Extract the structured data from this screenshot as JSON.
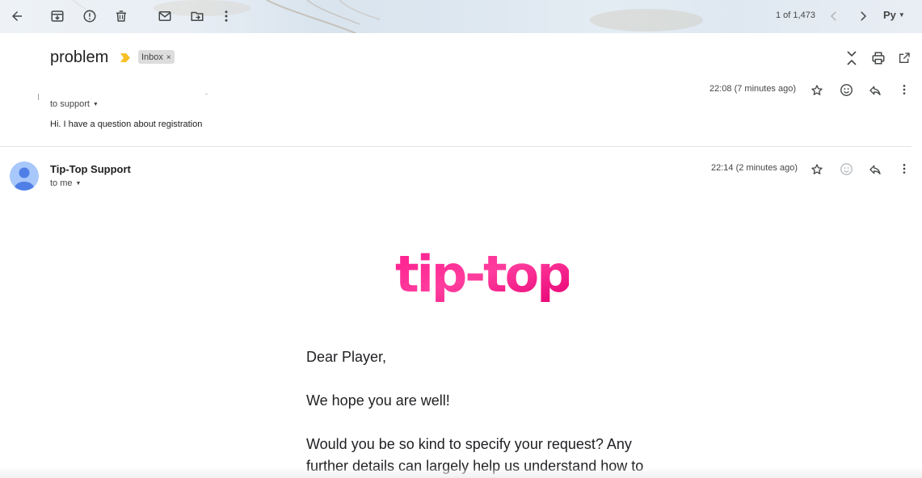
{
  "toolbar": {
    "buttons": [
      "back-arrow-icon",
      "archive-icon",
      "report-spam-icon",
      "delete-icon",
      "mark-unread-icon",
      "move-to-icon",
      "more-vert-icon"
    ],
    "pager_text": "1 of 1,473",
    "lang_label": "Py"
  },
  "thread": {
    "subject": "problem",
    "label": "Inbox",
    "label_close": "×",
    "header_icons": [
      "collapse-all-icon",
      "print-icon",
      "open-new-window-icon"
    ]
  },
  "messages": [
    {
      "to": "to support",
      "time": "22:08 (7 minutes ago)",
      "snippet": "Hi. I have a question about registration"
    },
    {
      "sender": "Tip-Top Support",
      "to": "to me",
      "time": "22:14 (2 minutes ago)"
    }
  ],
  "email_body": {
    "logo_text": "tip-top",
    "greeting": "Dear Player,",
    "line1": "We hope you are well!",
    "para_line1": "Would you be so kind to specify your request? Any",
    "para_line2": "further details can largely help us understand how to"
  },
  "colors": {
    "logo_pink": "#ff1a8c",
    "important_yellow": "#f6c026",
    "avatar_bg": "#a8c7fa"
  }
}
